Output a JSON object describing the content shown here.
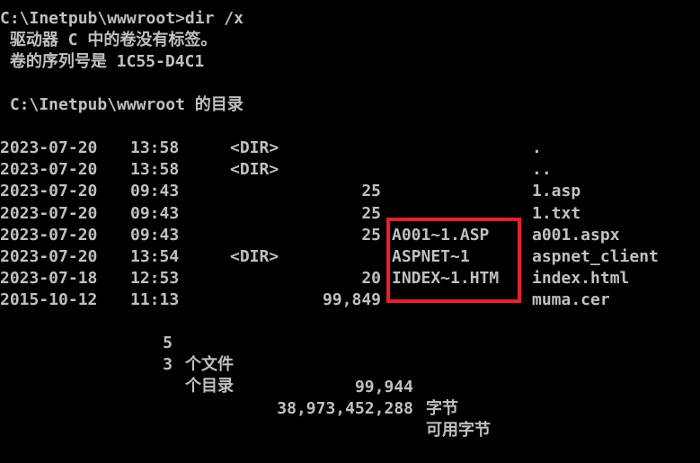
{
  "window": {
    "prompt_command": "C:\\Inetpub\\wwwroot>dir /x",
    "volume_line": " 驱动器 C 中的卷没有标签。",
    "serial_line": " 卷的序列号是 1C55-D4C1",
    "directory_line": " C:\\Inetpub\\wwwroot 的目录"
  },
  "entries": [
    {
      "date": "2023-07-20",
      "time": "13:58",
      "dir": "<DIR>",
      "size": "",
      "short": "",
      "name": "."
    },
    {
      "date": "2023-07-20",
      "time": "13:58",
      "dir": "<DIR>",
      "size": "",
      "short": "",
      "name": ".."
    },
    {
      "date": "2023-07-20",
      "time": "09:43",
      "dir": "",
      "size": "25",
      "short": "",
      "name": "1.asp"
    },
    {
      "date": "2023-07-20",
      "time": "09:43",
      "dir": "",
      "size": "25",
      "short": "",
      "name": "1.txt"
    },
    {
      "date": "2023-07-20",
      "time": "09:43",
      "dir": "",
      "size": "25",
      "short": "A001~1.ASP",
      "name": "a001.aspx"
    },
    {
      "date": "2023-07-20",
      "time": "13:54",
      "dir": "<DIR>",
      "size": "",
      "short": "ASPNET~1",
      "name": "aspnet_client"
    },
    {
      "date": "2023-07-18",
      "time": "12:53",
      "dir": "",
      "size": "20",
      "short": "INDEX~1.HTM",
      "name": "index.html"
    },
    {
      "date": "2015-10-12",
      "time": "11:13",
      "dir": "",
      "size": "99,849",
      "short": "",
      "name": "muma.cer"
    }
  ],
  "summary": {
    "files_count": "5",
    "files_label": "个文件",
    "files_bytes": "99,944",
    "files_unit": "字节",
    "dirs_count": "3",
    "dirs_label": "个目录",
    "dirs_bytes": "38,973,452,288",
    "dirs_unit": "可用字节"
  },
  "colors": {
    "background": "#000000",
    "text": "#c0c0c0",
    "highlight": "#e8202a"
  }
}
